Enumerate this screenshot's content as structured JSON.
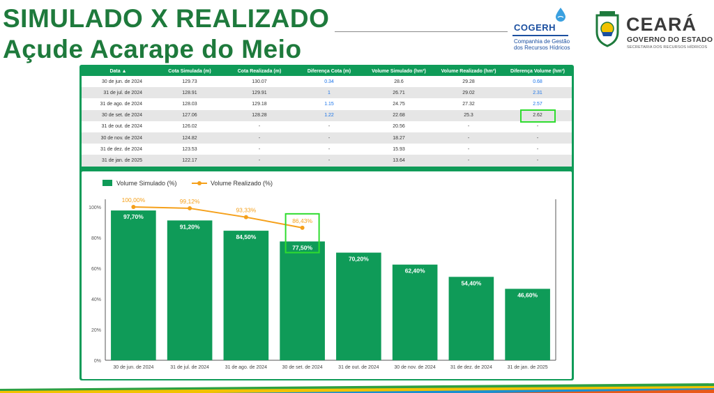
{
  "header": {
    "title_line1": "SIMULADO X REALIZADO",
    "title_line2": "Açude Acarape do Meio"
  },
  "logos": {
    "cogerh_name": "COGERH",
    "cogerh_sub": "Companhia de Gestão dos Recursos Hídricos",
    "ceara_name": "CEARÁ",
    "ceara_gov": "GOVERNO DO ESTADO",
    "ceara_sec": "SECRETARIA DOS RECURSOS HÍDRICOS"
  },
  "table": {
    "headers": [
      "Data ▲",
      "Cota Simulada (m)",
      "Cota Realizada (m)",
      "Diferença Cota (m)",
      "Volume Simulado (hm³)",
      "Volume Realizado (hm³)",
      "Diferença Volume (hm³)"
    ],
    "rows": [
      [
        "30 de jun. de 2024",
        "129.73",
        "130.07",
        "0.34",
        "28.6",
        "29.28",
        "0.68"
      ],
      [
        "31 de jul. de 2024",
        "128.91",
        "129.91",
        "1",
        "26.71",
        "29.02",
        "2.31"
      ],
      [
        "31 de ago. de 2024",
        "128.03",
        "129.18",
        "1.15",
        "24.75",
        "27.32",
        "2.57"
      ],
      [
        "30 de set. de 2024",
        "127.06",
        "128.28",
        "1.22",
        "22.68",
        "25.3",
        "2.62"
      ],
      [
        "31 de out. de 2024",
        "126.02",
        "-",
        "-",
        "20.56",
        "-",
        "-"
      ],
      [
        "30 de nov. de 2024",
        "124.82",
        "-",
        "-",
        "18.27",
        "-",
        "-"
      ],
      [
        "31 de dez. de 2024",
        "123.53",
        "-",
        "-",
        "15.93",
        "-",
        "-"
      ],
      [
        "31 de jan. de 2025",
        "122.17",
        "-",
        "-",
        "13.64",
        "-",
        "-"
      ]
    ]
  },
  "colors": {
    "bar": "#0f9b58",
    "line": "#f5a01a",
    "highlight": "#2fdc2f",
    "title": "#1e7a3c"
  },
  "chart_data": {
    "type": "bar",
    "categories": [
      "30 de jun. de 2024",
      "31 de jul. de 2024",
      "31 de ago. de 2024",
      "30 de set. de 2024",
      "31 de out. de 2024",
      "30 de nov. de 2024",
      "31 de dez. de 2024",
      "31 de jan. de 2025"
    ],
    "series": [
      {
        "name": "Volume Simulado (%)",
        "type": "bar",
        "values": [
          97.7,
          91.2,
          84.5,
          77.5,
          70.2,
          62.4,
          54.4,
          46.6
        ],
        "labels": [
          "97,70%",
          "91,20%",
          "84,50%",
          "77,50%",
          "70,20%",
          "62,40%",
          "54,40%",
          "46,60%"
        ]
      },
      {
        "name": "Volume Realizado (%)",
        "type": "line",
        "values": [
          100.0,
          99.12,
          93.33,
          86.43,
          null,
          null,
          null,
          null
        ],
        "labels": [
          "100,00%",
          "99,12%",
          "93,33%",
          "86,43%",
          null,
          null,
          null,
          null
        ]
      }
    ],
    "y_ticks": [
      "0%",
      "20%",
      "40%",
      "60%",
      "80%",
      "100%"
    ],
    "ylim": [
      0,
      100
    ],
    "legend": "top-left",
    "grid": false,
    "highlight_index": 3
  }
}
